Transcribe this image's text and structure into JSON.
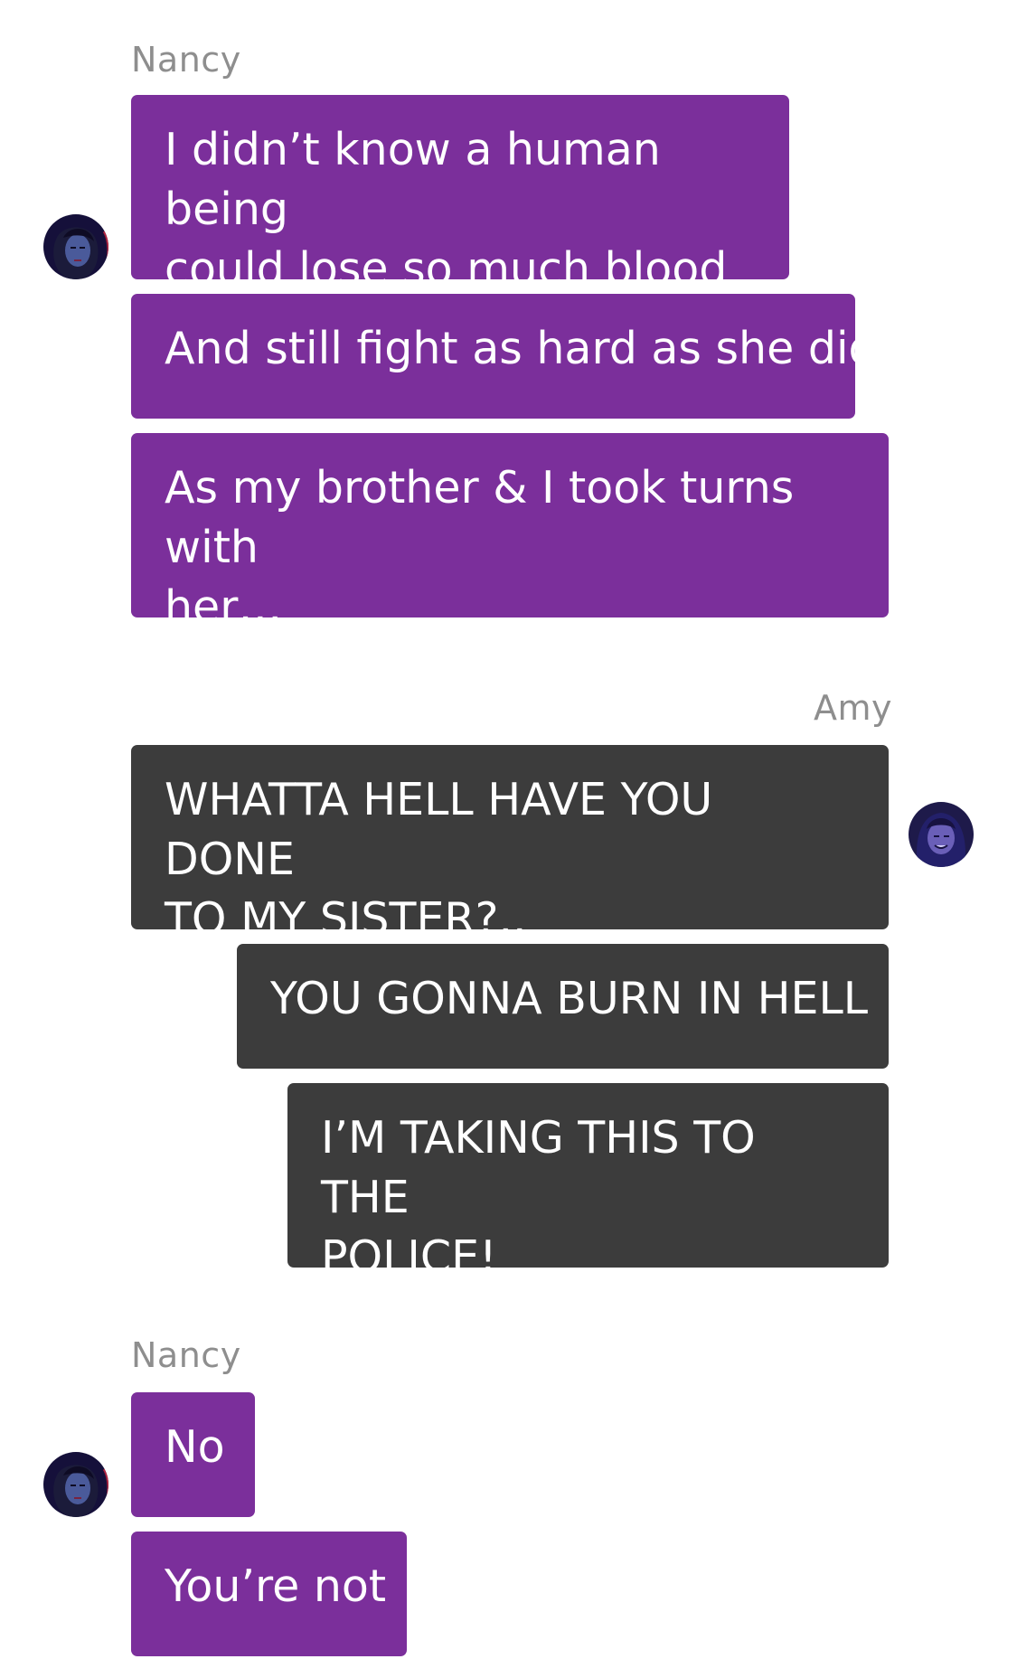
{
  "thread": {
    "groups": [
      {
        "sender": "Nancy",
        "messages": [
          "I didn’t know a human being\ncould lose so much blood",
          "And still fight as hard as she did",
          "As my brother & I took turns with\nher…"
        ]
      },
      {
        "sender": "Amy",
        "messages": [
          "WHATTA HELL HAVE YOU DONE\nTO MY SISTER?..",
          "YOU GONNA BURN IN HELL",
          "I’M TAKING THIS TO THE\nPOLICE!"
        ]
      },
      {
        "sender": "Nancy",
        "messages": [
          "No",
          "You’re not"
        ]
      }
    ]
  },
  "colors": {
    "nancy_bubble": "#7b2f9b",
    "amy_bubble": "#3c3c3c",
    "sender_name": "#8e8e8e"
  },
  "icons": {
    "nancy_avatar": "nancy-avatar-icon",
    "amy_avatar": "amy-avatar-icon"
  }
}
